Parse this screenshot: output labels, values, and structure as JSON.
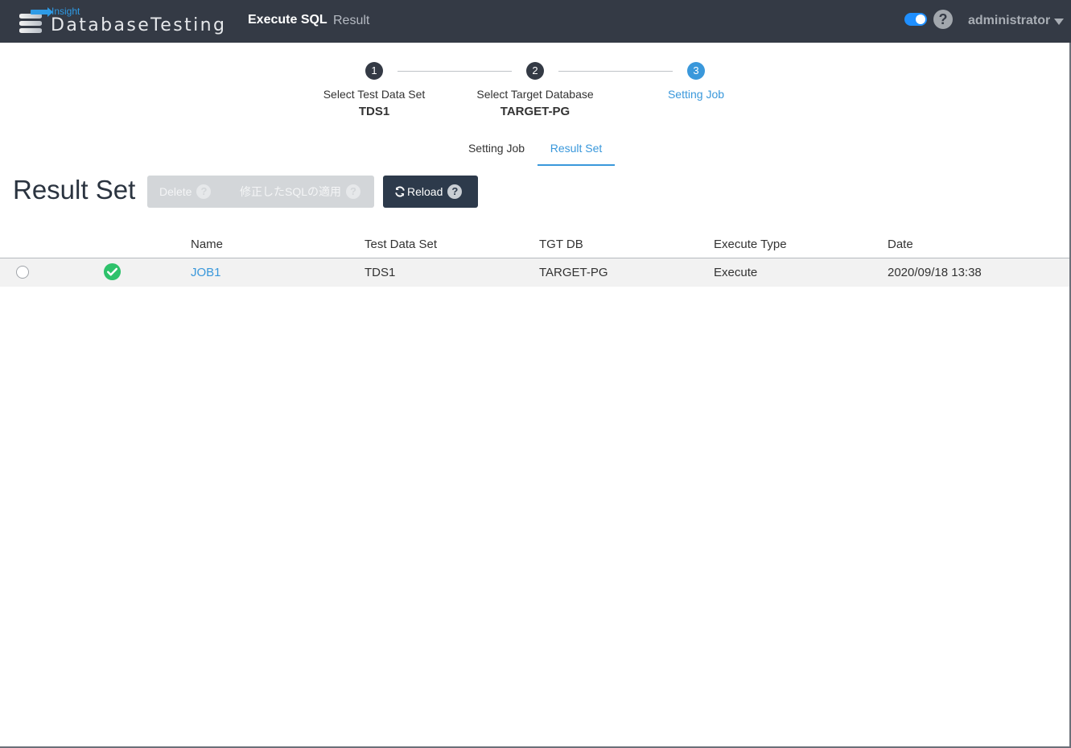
{
  "header": {
    "logo_insight": "Insight",
    "logo_name": "DatabaseTesting",
    "nav_execute": "Execute SQL",
    "nav_result": "Result",
    "help": "?",
    "user": "administrator",
    "toggle_on": true
  },
  "steps": [
    {
      "num": "1",
      "title": "Select Test Data Set",
      "value": "TDS1"
    },
    {
      "num": "2",
      "title": "Select Target Database",
      "value": "TARGET-PG"
    },
    {
      "num": "3",
      "title": "Setting Job",
      "value": ""
    }
  ],
  "tabs": {
    "setting": "Setting Job",
    "result": "Result Set"
  },
  "page_title": "Result Set",
  "toolbar": {
    "delete": "Delete",
    "apply_sql": "修正したSQLの適用",
    "reload": "Reload",
    "help": "?"
  },
  "table": {
    "headers": [
      "Name",
      "Test Data Set",
      "TGT DB",
      "Execute Type",
      "Date"
    ],
    "rows": [
      {
        "name": "JOB1",
        "test_data_set": "TDS1",
        "tgt_db": "TARGET-PG",
        "execute_type": "Execute",
        "date": "2020/09/18 13:38",
        "status": "success"
      }
    ]
  },
  "colors": {
    "topbar": "#343a45",
    "accent": "#3a98db",
    "success": "#2ec26b"
  }
}
